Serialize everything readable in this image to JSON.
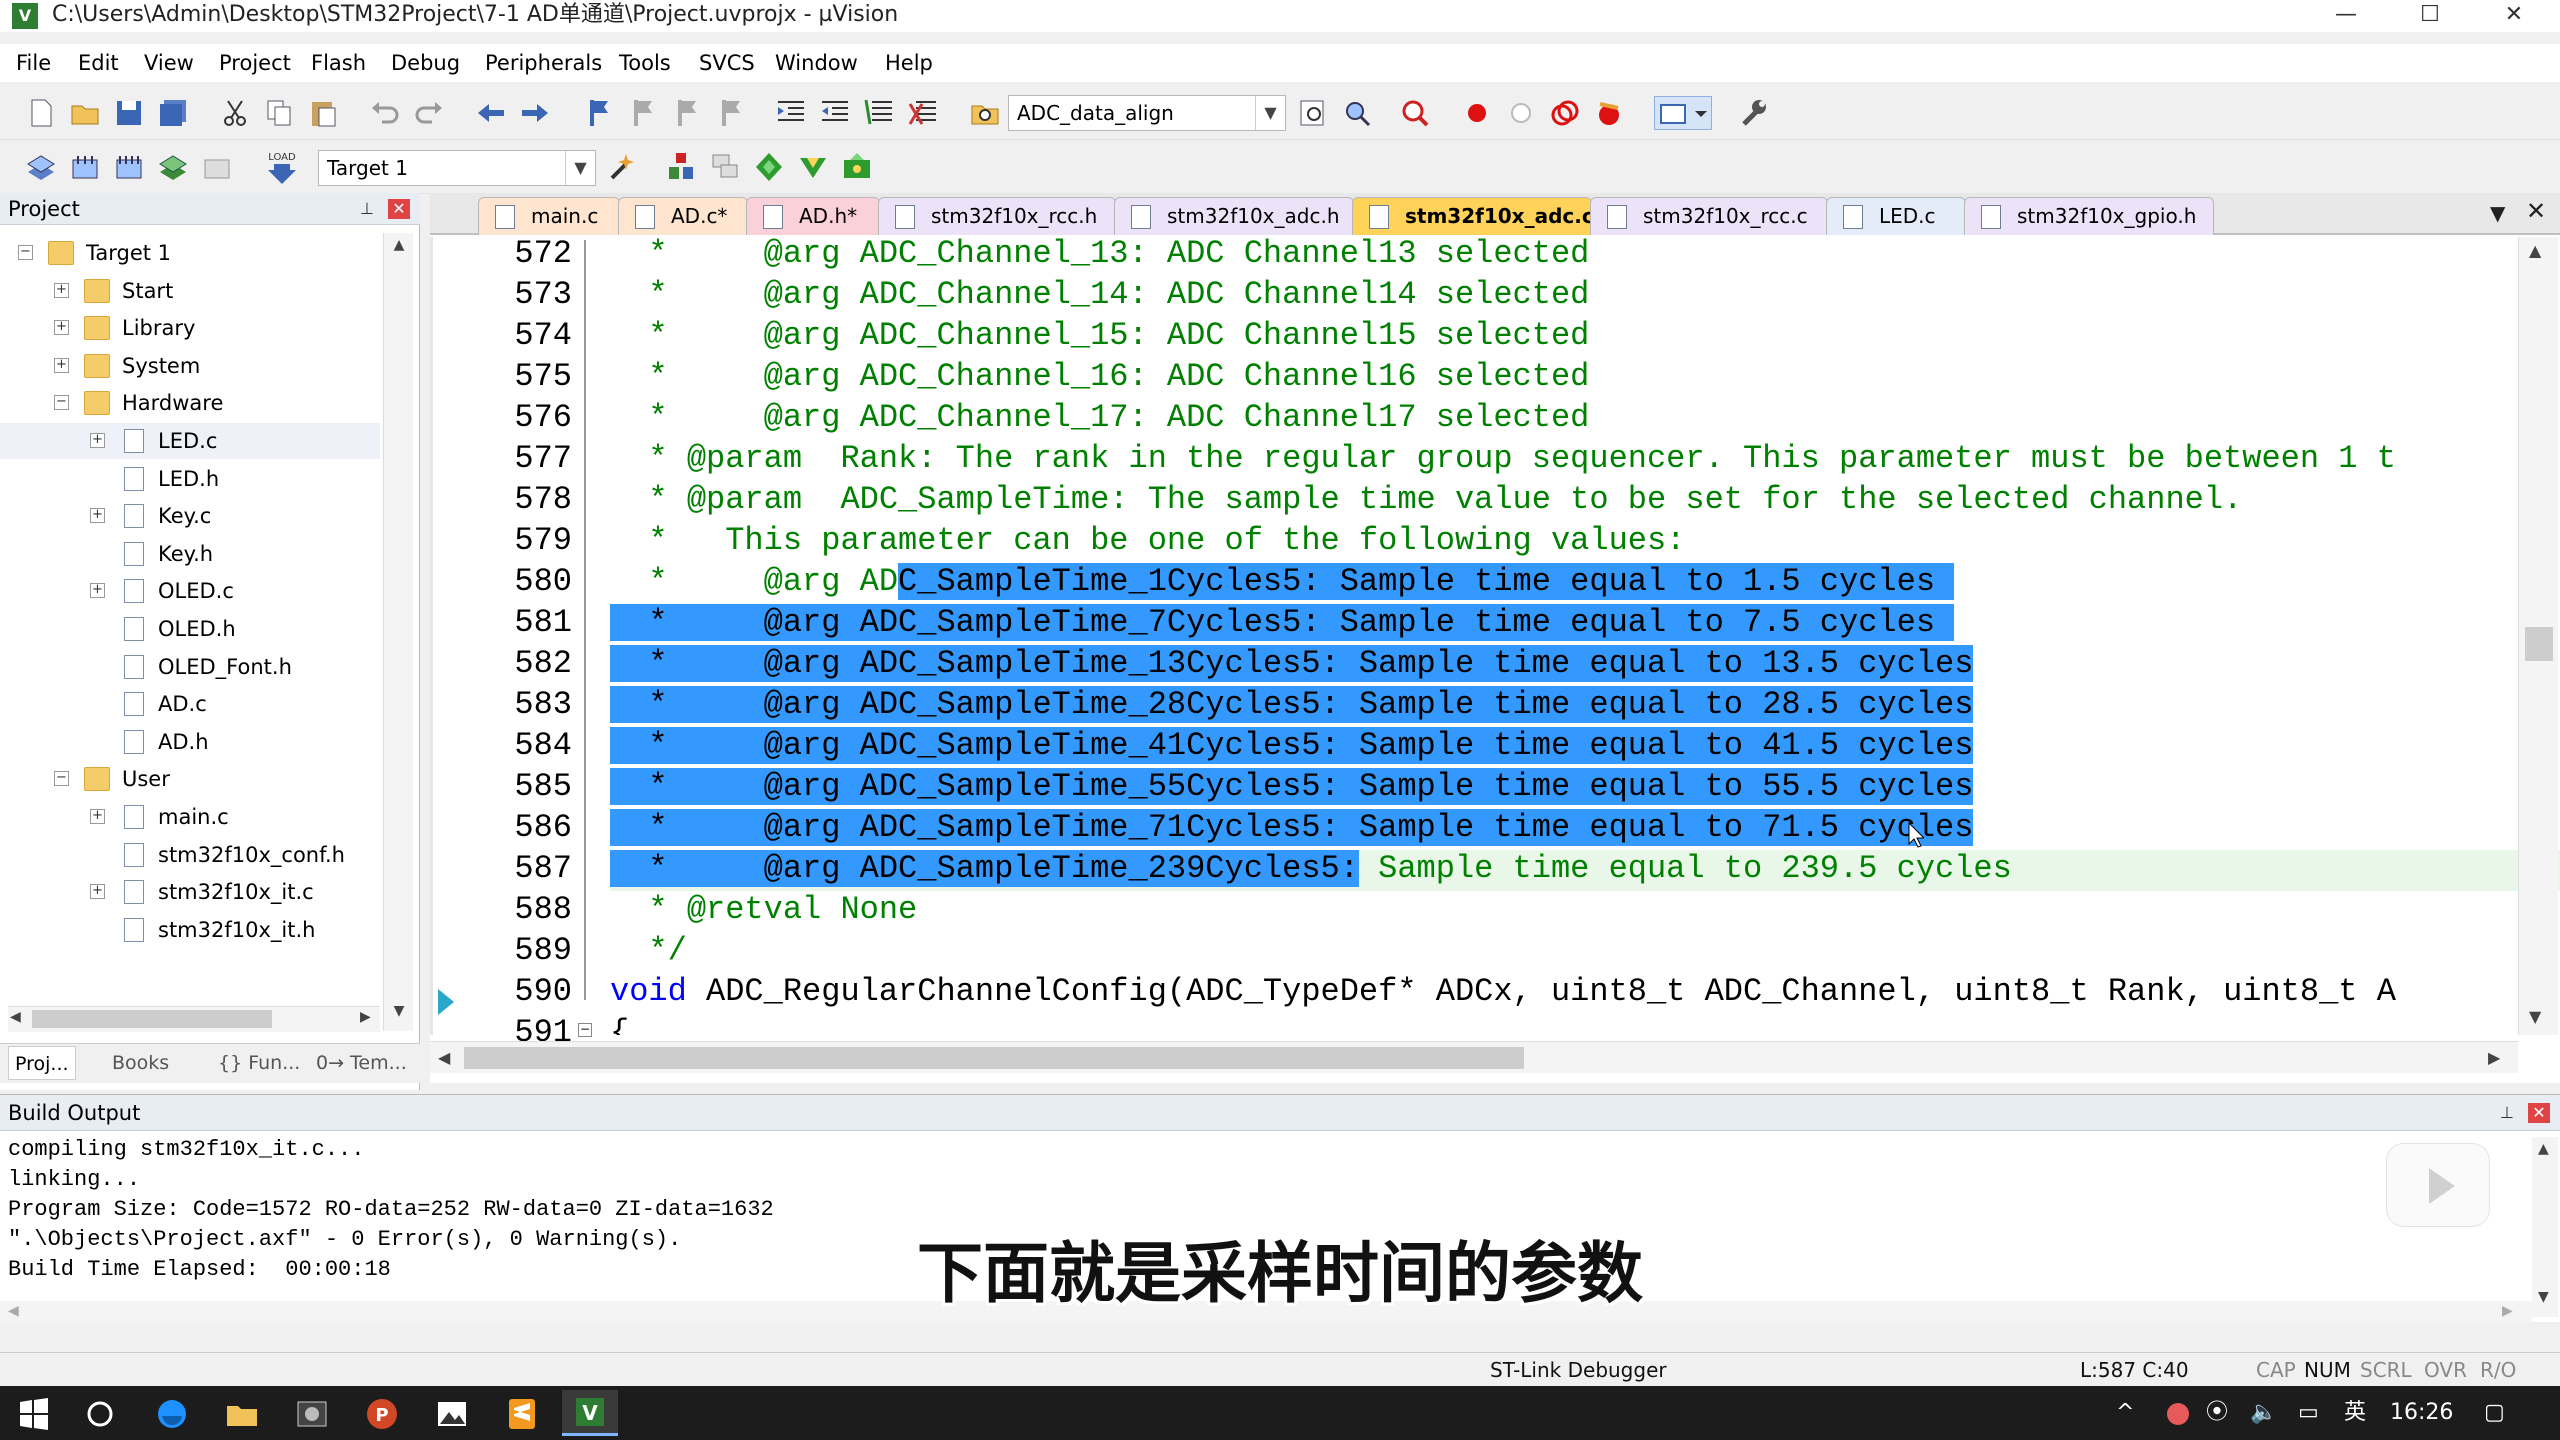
{
  "window": {
    "title": "C:\\Users\\Admin\\Desktop\\STM32Project\\7-1 AD单通道\\Project.uvprojx - µVision",
    "app_icon": "V"
  },
  "menu": [
    "File",
    "Edit",
    "View",
    "Project",
    "Flash",
    "Debug",
    "Peripherals",
    "Tools",
    "SVCS",
    "Window",
    "Help"
  ],
  "toolbar1": {
    "find_combo_value": "ADC_data_align"
  },
  "toolbar2": {
    "load_label": "LOAD",
    "target_combo_value": "Target 1"
  },
  "project_pane": {
    "title": "Project",
    "tree": [
      {
        "label": "Target 1",
        "level": 0,
        "kind": "target",
        "toggle": "−"
      },
      {
        "label": "Start",
        "level": 1,
        "kind": "folder",
        "toggle": "+"
      },
      {
        "label": "Library",
        "level": 1,
        "kind": "folder",
        "toggle": "+"
      },
      {
        "label": "System",
        "level": 1,
        "kind": "folder",
        "toggle": "+"
      },
      {
        "label": "Hardware",
        "level": 1,
        "kind": "folder",
        "toggle": "−"
      },
      {
        "label": "LED.c",
        "level": 2,
        "kind": "file",
        "toggle": "+"
      },
      {
        "label": "LED.h",
        "level": 2,
        "kind": "file",
        "toggle": ""
      },
      {
        "label": "Key.c",
        "level": 2,
        "kind": "file",
        "toggle": "+"
      },
      {
        "label": "Key.h",
        "level": 2,
        "kind": "file",
        "toggle": ""
      },
      {
        "label": "OLED.c",
        "level": 2,
        "kind": "file",
        "toggle": "+"
      },
      {
        "label": "OLED.h",
        "level": 2,
        "kind": "file",
        "toggle": ""
      },
      {
        "label": "OLED_Font.h",
        "level": 2,
        "kind": "file",
        "toggle": ""
      },
      {
        "label": "AD.c",
        "level": 2,
        "kind": "file",
        "toggle": ""
      },
      {
        "label": "AD.h",
        "level": 2,
        "kind": "file",
        "toggle": ""
      },
      {
        "label": "User",
        "level": 1,
        "kind": "folder",
        "toggle": "−"
      },
      {
        "label": "main.c",
        "level": 2,
        "kind": "file",
        "toggle": "+"
      },
      {
        "label": "stm32f10x_conf.h",
        "level": 2,
        "kind": "file",
        "toggle": ""
      },
      {
        "label": "stm32f10x_it.c",
        "level": 2,
        "kind": "file",
        "toggle": "+"
      },
      {
        "label": "stm32f10x_it.h",
        "level": 2,
        "kind": "file",
        "toggle": ""
      }
    ],
    "bottom_tabs": [
      "Proj...",
      "Books",
      "{} Fun...",
      "0→ Tem..."
    ]
  },
  "editor": {
    "tabs": [
      {
        "label": "main.c",
        "active": false
      },
      {
        "label": "AD.c*",
        "active": false
      },
      {
        "label": "AD.h*",
        "active": false
      },
      {
        "label": "stm32f10x_rcc.h",
        "active": false
      },
      {
        "label": "stm32f10x_adc.h",
        "active": false
      },
      {
        "label": "stm32f10x_adc.c",
        "active": true
      },
      {
        "label": "stm32f10x_rcc.c",
        "active": false
      },
      {
        "label": "LED.c",
        "active": false
      },
      {
        "label": "stm32f10x_gpio.h",
        "active": false
      }
    ],
    "lines": [
      {
        "num": "572",
        "pre": "  *     @arg ADC_Channel_13: ADC Channel13 selected",
        "sel": "",
        "post": "",
        "type": "comment"
      },
      {
        "num": "573",
        "pre": "  *     @arg ADC_Channel_14: ADC Channel14 selected",
        "sel": "",
        "post": "",
        "type": "comment"
      },
      {
        "num": "574",
        "pre": "  *     @arg ADC_Channel_15: ADC Channel15 selected",
        "sel": "",
        "post": "",
        "type": "comment"
      },
      {
        "num": "575",
        "pre": "  *     @arg ADC_Channel_16: ADC Channel16 selected",
        "sel": "",
        "post": "",
        "type": "comment"
      },
      {
        "num": "576",
        "pre": "  *     @arg ADC_Channel_17: ADC Channel17 selected",
        "sel": "",
        "post": "",
        "type": "comment"
      },
      {
        "num": "577",
        "pre": "  * @param  Rank: The rank in the regular group sequencer. This parameter must be between 1 t",
        "sel": "",
        "post": "",
        "type": "comment"
      },
      {
        "num": "578",
        "pre": "  * @param  ADC_SampleTime: The sample time value to be set for the selected channel.",
        "sel": "",
        "post": "",
        "type": "comment"
      },
      {
        "num": "579",
        "pre": "  *   This parameter can be one of the following values:",
        "sel": "",
        "post": "",
        "type": "comment"
      },
      {
        "num": "580",
        "pre": "  *     @arg AD",
        "sel": "C_SampleTime_1Cycles5: Sample time equal to 1.5 cycles ",
        "post": "",
        "type": "comment"
      },
      {
        "num": "581",
        "pre": "",
        "sel": "  *     @arg ADC_SampleTime_7Cycles5: Sample time equal to 7.5 cycles ",
        "post": "",
        "type": "comment"
      },
      {
        "num": "582",
        "pre": "",
        "sel": "  *     @arg ADC_SampleTime_13Cycles5: Sample time equal to 13.5 cycles",
        "post": "",
        "type": "comment"
      },
      {
        "num": "583",
        "pre": "",
        "sel": "  *     @arg ADC_SampleTime_28Cycles5: Sample time equal to 28.5 cycles",
        "post": "",
        "type": "comment"
      },
      {
        "num": "584",
        "pre": "",
        "sel": "  *     @arg ADC_SampleTime_41Cycles5: Sample time equal to 41.5 cycles",
        "post": "",
        "type": "comment"
      },
      {
        "num": "585",
        "pre": "",
        "sel": "  *     @arg ADC_SampleTime_55Cycles5: Sample time equal to 55.5 cycles",
        "post": "",
        "type": "comment"
      },
      {
        "num": "586",
        "pre": "",
        "sel": "  *     @arg ADC_SampleTime_71Cycles5: Sample time equal to 71.5 cycles",
        "post": "",
        "type": "comment"
      },
      {
        "num": "587",
        "pre": "",
        "sel": "  *     @arg ADC_SampleTime_239Cycles5:",
        "post": " Sample time equal to 239.5 cycles",
        "type": "comment"
      },
      {
        "num": "588",
        "pre": "  * @retval None",
        "sel": "",
        "post": "",
        "type": "comment"
      },
      {
        "num": "589",
        "pre": "  */",
        "sel": "",
        "post": "",
        "type": "comment"
      },
      {
        "num": "590",
        "pre": "void",
        "sel": "",
        "post": " ADC_RegularChannelConfig(ADC_TypeDef* ADCx, uint8_t ADC_Channel, uint8_t Rank, uint8_t A",
        "type": "code"
      },
      {
        "num": "591",
        "pre": "{",
        "sel": "",
        "post": "",
        "type": "code"
      }
    ]
  },
  "build_output": {
    "title": "Build Output",
    "lines": [
      "compiling stm32f10x_it.c...",
      "linking...",
      "Program Size: Code=1572 RO-data=252 RW-data=0 ZI-data=1632",
      "\".\\Objects\\Project.axf\" - 0 Error(s), 0 Warning(s).",
      "Build Time Elapsed:  00:00:18"
    ]
  },
  "subtitle": "下面就是采样时间的参数",
  "status": {
    "debugger": "ST-Link Debugger",
    "position": "L:587 C:40",
    "indicators": [
      "CAP",
      "NUM",
      "SCRL",
      "OVR",
      "R/O"
    ]
  },
  "taskbar": {
    "ime": "英",
    "time": "16:26"
  },
  "colors": {
    "selection": "#3399ff",
    "comment": "#008000",
    "keyword": "#0000ff",
    "active_tab": "#ffd35a",
    "current_line": "#e8f7e8"
  }
}
